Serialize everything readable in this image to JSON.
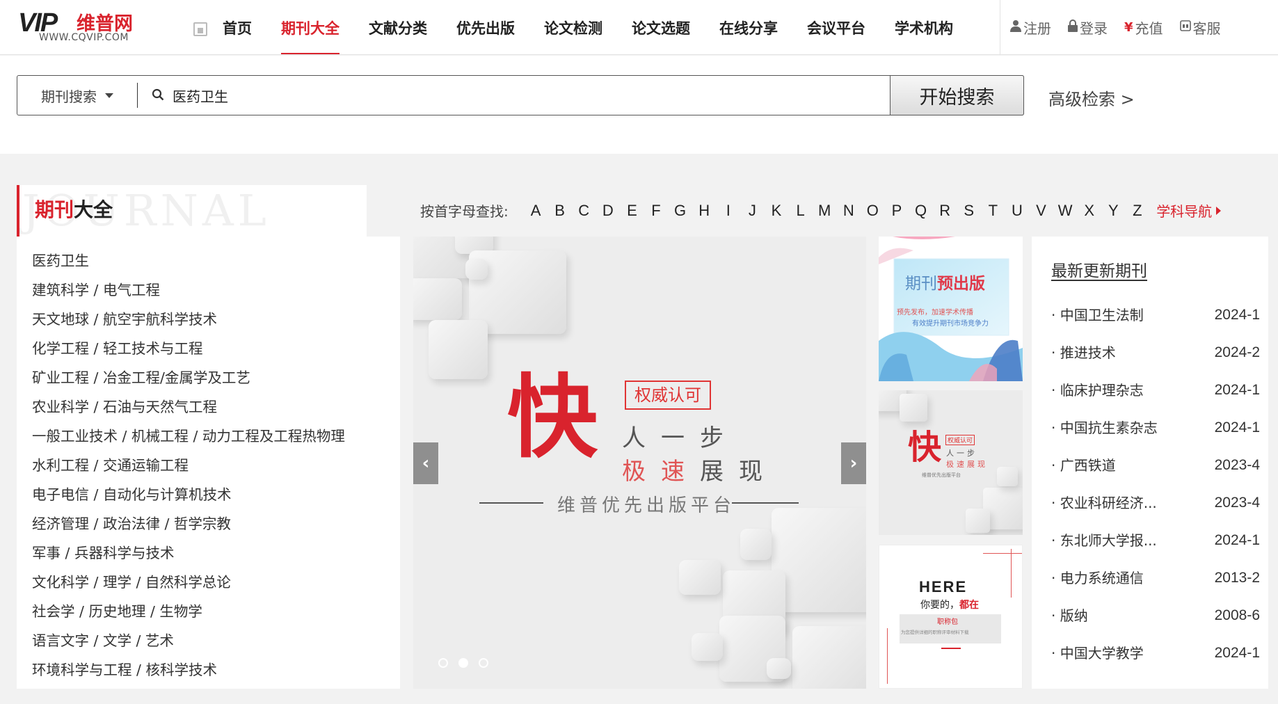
{
  "header": {
    "logo_mark": "VIP",
    "logo_cn": "维普网",
    "logo_url": "WWW.CQVIP.COM",
    "nav": [
      {
        "label": "首页",
        "active": false
      },
      {
        "label": "期刊大全",
        "active": true
      },
      {
        "label": "文献分类",
        "active": false
      },
      {
        "label": "优先出版",
        "active": false
      },
      {
        "label": "论文检测",
        "active": false
      },
      {
        "label": "论文选题",
        "active": false
      },
      {
        "label": "在线分享",
        "active": false
      },
      {
        "label": "会议平台",
        "active": false
      },
      {
        "label": "学术机构",
        "active": false
      }
    ],
    "user_links": {
      "register": "注册",
      "login": "登录",
      "recharge": "充值",
      "service": "客服"
    }
  },
  "search": {
    "type_label": "期刊搜索",
    "query": "医药卫生",
    "button_label": "开始搜索",
    "advanced_label": "高级检索 >"
  },
  "section": {
    "title_red": "期刊",
    "title_black": "大全",
    "watermark": "JOURNAL",
    "alpha_label": "按首字母查找:",
    "letters": [
      "A",
      "B",
      "C",
      "D",
      "E",
      "F",
      "G",
      "H",
      "I",
      "J",
      "K",
      "L",
      "M",
      "N",
      "O",
      "P",
      "Q",
      "R",
      "S",
      "T",
      "U",
      "V",
      "W",
      "X",
      "Y",
      "Z"
    ],
    "subject_nav": "学科导航"
  },
  "categories": [
    "医药卫生",
    "建筑科学 / 电气工程",
    "天文地球 / 航空宇航科学技术",
    "化学工程 / 轻工技术与工程",
    "矿业工程 / 冶金工程/金属学及工艺",
    "农业科学 / 石油与天然气工程",
    "一般工业技术 / 机械工程 / 动力工程及工程热物理",
    "水利工程 / 交通运输工程",
    "电子电信 / 自动化与计算机技术",
    "经济管理 / 政治法律 / 哲学宗教",
    "军事 / 兵器科学与技术",
    "文化科学 / 理学 / 自然科学总论",
    "社会学 / 历史地理 / 生物学",
    "语言文字 / 文学 / 艺术",
    "环境科学与工程 / 核科学技术"
  ],
  "carousel": {
    "badge": "权威认可",
    "big": "快",
    "line1": "人一步",
    "line2_red": "极速",
    "line2_gray": "展现",
    "subtitle": "维普优先出版平台",
    "prev": "‹",
    "next": "›",
    "slide_count": 3,
    "active_slide": 2
  },
  "ads": {
    "ad1_title_gray": "期刊",
    "ad1_title_red": "预出版",
    "ad1_line1": "预先发布，加速学术传播",
    "ad1_line2": "有效提升期刊市场竞争力",
    "ad2_badge": "权威认可",
    "ad2_big": "快",
    "ad2_line1": "人一步",
    "ad2_line2": "极速展现",
    "ad2_sub": "维普优先出版平台",
    "ad3_here": "HERE",
    "ad3_line_gray": "你要的，",
    "ad3_line_red": "都在",
    "ad3_tag": "职称包",
    "ad3_small": "为您提供详细的职称评审材料下载"
  },
  "latest": {
    "title": "最新更新期刊",
    "items": [
      {
        "name": "中国卫生法制",
        "date": "2024-1"
      },
      {
        "name": "推进技术",
        "date": "2024-2"
      },
      {
        "name": "临床护理杂志",
        "date": "2024-1"
      },
      {
        "name": "中国抗生素杂志",
        "date": "2024-1"
      },
      {
        "name": "广西铁道",
        "date": "2023-4"
      },
      {
        "name": "农业科研经济...",
        "date": "2023-4"
      },
      {
        "name": "东北师大学报...",
        "date": "2024-1"
      },
      {
        "name": "电力系统通信",
        "date": "2013-2"
      },
      {
        "name": "版纳",
        "date": "2008-6"
      },
      {
        "name": "中国大学教学",
        "date": "2024-1"
      }
    ]
  },
  "colors": {
    "accent": "#d9232d",
    "text": "#333333",
    "bg": "#f2f2f2"
  }
}
